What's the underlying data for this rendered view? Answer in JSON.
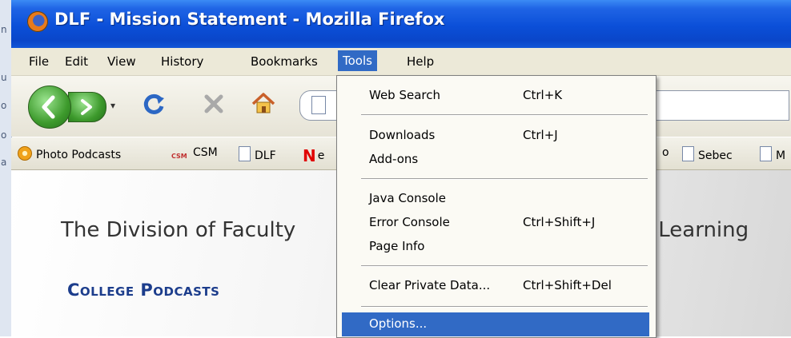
{
  "window": {
    "title": "DLF - Mission Statement - Mozilla Firefox"
  },
  "desktop_strip": [
    "n",
    "u",
    "o",
    "o",
    "a"
  ],
  "menubar": {
    "items": [
      {
        "label": "File"
      },
      {
        "label": "Edit"
      },
      {
        "label": "View"
      },
      {
        "label": "History"
      },
      {
        "label": "Bookmarks"
      },
      {
        "label": "Tools"
      },
      {
        "label": "Help"
      }
    ],
    "open_menu": "Tools"
  },
  "navbar": {
    "back_icon": "back-arrow-icon",
    "forward_icon": "forward-arrow-icon",
    "history_dropdown": "▾",
    "reload_icon": "reload-icon",
    "stop_icon": "stop-icon",
    "home_icon": "home-icon"
  },
  "bookmarks": [
    {
      "label": "Photo Podcasts",
      "icon": "podcast-icon"
    },
    {
      "label": "CSM",
      "icon": "csm-icon"
    },
    {
      "label": "DLF",
      "icon": "page-icon"
    },
    {
      "label": "e",
      "icon": "n-logo-icon"
    },
    {
      "label": "o",
      "icon": ""
    },
    {
      "label": "Sebec",
      "icon": "page-icon"
    },
    {
      "label": "M",
      "icon": "page-icon"
    }
  ],
  "content": {
    "heading_start": "The Division of Faculty",
    "heading_end": "e Learning",
    "section_title": "College Podcasts"
  },
  "tools_menu": {
    "items": [
      {
        "label": "Web Search",
        "shortcut": "Ctrl+K"
      },
      {
        "label": "Downloads",
        "shortcut": "Ctrl+J"
      },
      {
        "label": "Add-ons",
        "shortcut": ""
      },
      {
        "label": "Java Console",
        "shortcut": ""
      },
      {
        "label": "Error Console",
        "shortcut": "Ctrl+Shift+J"
      },
      {
        "label": "Page Info",
        "shortcut": ""
      },
      {
        "label": "Clear Private Data...",
        "shortcut": "Ctrl+Shift+Del"
      },
      {
        "label": "Options...",
        "shortcut": ""
      }
    ],
    "highlighted": "Options..."
  },
  "colors": {
    "titlebar": "#0a4fd8",
    "menu_highlight": "#316ac5",
    "section_title": "#1c3d8c"
  }
}
